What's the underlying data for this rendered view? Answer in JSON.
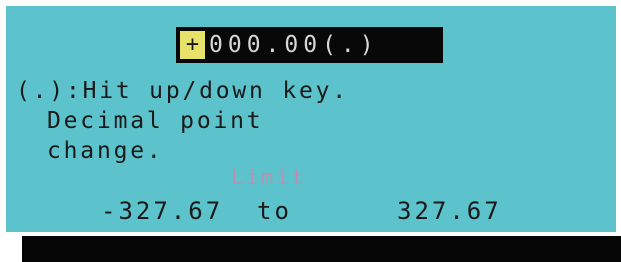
{
  "display": {
    "sign_cursor": "+",
    "value": "000.00(.)"
  },
  "help": {
    "line1": "(.):Hit up/down key.",
    "line2": "Decimal point",
    "line3": "change."
  },
  "limit": {
    "title": "Limit",
    "min": "-327.67",
    "to": "to",
    "max": "327.67"
  },
  "colors": {
    "lcd_background": "#5cc3cc",
    "cursor_highlight": "#e7e36a",
    "limit_label": "#c38db0"
  }
}
